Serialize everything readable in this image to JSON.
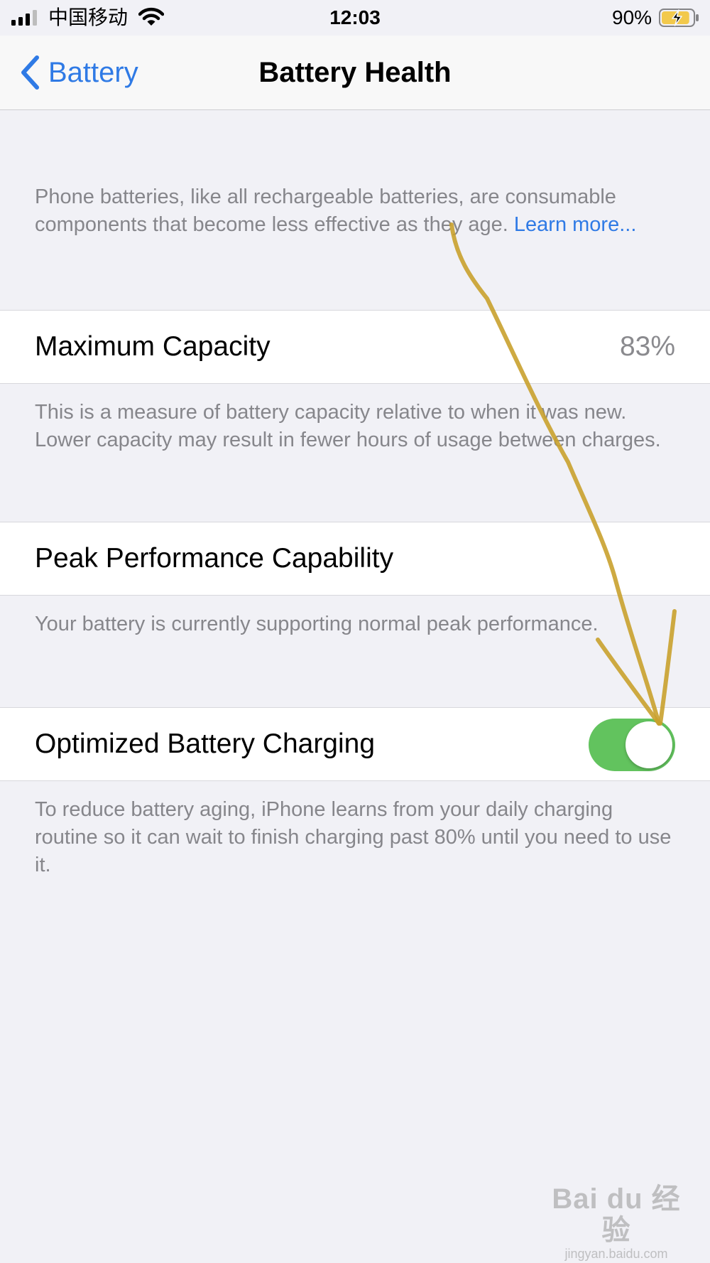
{
  "status_bar": {
    "carrier": "中国移动",
    "time": "12:03",
    "battery_percent": "90%",
    "battery_level": 0.9,
    "charging": true,
    "signal_bars": 3,
    "icons": [
      "signal-icon",
      "wifi-icon",
      "battery-charging-icon"
    ],
    "battery_color": "#f2c94c"
  },
  "nav": {
    "back_label": "Battery",
    "title": "Battery Health",
    "accent_color": "#2f7ae5"
  },
  "intro": {
    "text": "Phone batteries, like all rechargeable batteries, are consumable components that become less effective as they age.",
    "link": "Learn more..."
  },
  "max_capacity": {
    "label": "Maximum Capacity",
    "value": "83%",
    "description": "This is a measure of battery capacity relative to when it was new. Lower capacity may result in fewer hours of usage between charges."
  },
  "peak_performance": {
    "label": "Peak Performance Capability",
    "description": "Your battery is currently supporting normal peak performance."
  },
  "optimized_charging": {
    "label": "Optimized Battery Charging",
    "enabled": true,
    "toggle_color": "#62c35e",
    "description": "To reduce battery aging, iPhone learns from your daily charging routine so it can wait to finish charging past 80% until you need to use it."
  },
  "annotation": {
    "type": "hand-drawn-arrow",
    "color": "#c9a12e",
    "points_to": "optimized-charging-toggle"
  },
  "watermark": {
    "main": "Bai du 经验",
    "sub": "jingyan.baidu.com"
  }
}
